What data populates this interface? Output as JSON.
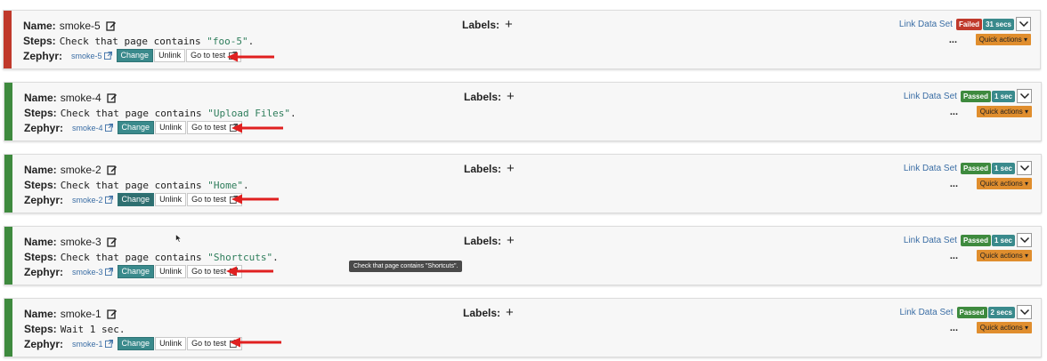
{
  "labels": {
    "name": "Name:",
    "steps": "Steps:",
    "zephyr": "Zephyr:",
    "labels": "Labels:",
    "plus": "+",
    "change": "Change",
    "unlink": "Unlink",
    "go_to_test": "Go to test",
    "link_data_set": "Link Data Set",
    "dots": "...",
    "quick_actions": "Quick actions ▾"
  },
  "colors": {
    "failed": "#c0392b",
    "passed": "#3e8a3e",
    "time": "#3a8a8c",
    "quick": "#e08e2e",
    "arrow": "#e02020"
  },
  "tests": [
    {
      "name": "smoke-5",
      "steps_prefix": "Check that page contains ",
      "steps_string": "\"foo-5\"",
      "steps_suffix": ".",
      "zephyr": "smoke-5",
      "status": "Failed",
      "duration": "31 secs"
    },
    {
      "name": "smoke-4",
      "steps_prefix": "Check that page contains ",
      "steps_string": "\"Upload Files\"",
      "steps_suffix": ".",
      "zephyr": "smoke-4",
      "status": "Passed",
      "duration": "1 sec"
    },
    {
      "name": "smoke-2",
      "steps_prefix": "Check that page contains ",
      "steps_string": "\"Home\"",
      "steps_suffix": ".",
      "zephyr": "smoke-2",
      "status": "Passed",
      "duration": "1 sec"
    },
    {
      "name": "smoke-3",
      "steps_prefix": "Check that page contains ",
      "steps_string": "\"Shortcuts\"",
      "steps_suffix": ".",
      "zephyr": "smoke-3",
      "status": "Passed",
      "duration": "1 sec"
    },
    {
      "name": "smoke-1",
      "steps_prefix": "Wait 1 sec.",
      "steps_string": "",
      "steps_suffix": "",
      "zephyr": "smoke-1",
      "status": "Passed",
      "duration": "2 secs"
    }
  ],
  "tooltip": "Check that page contains \"Shortcuts\"."
}
